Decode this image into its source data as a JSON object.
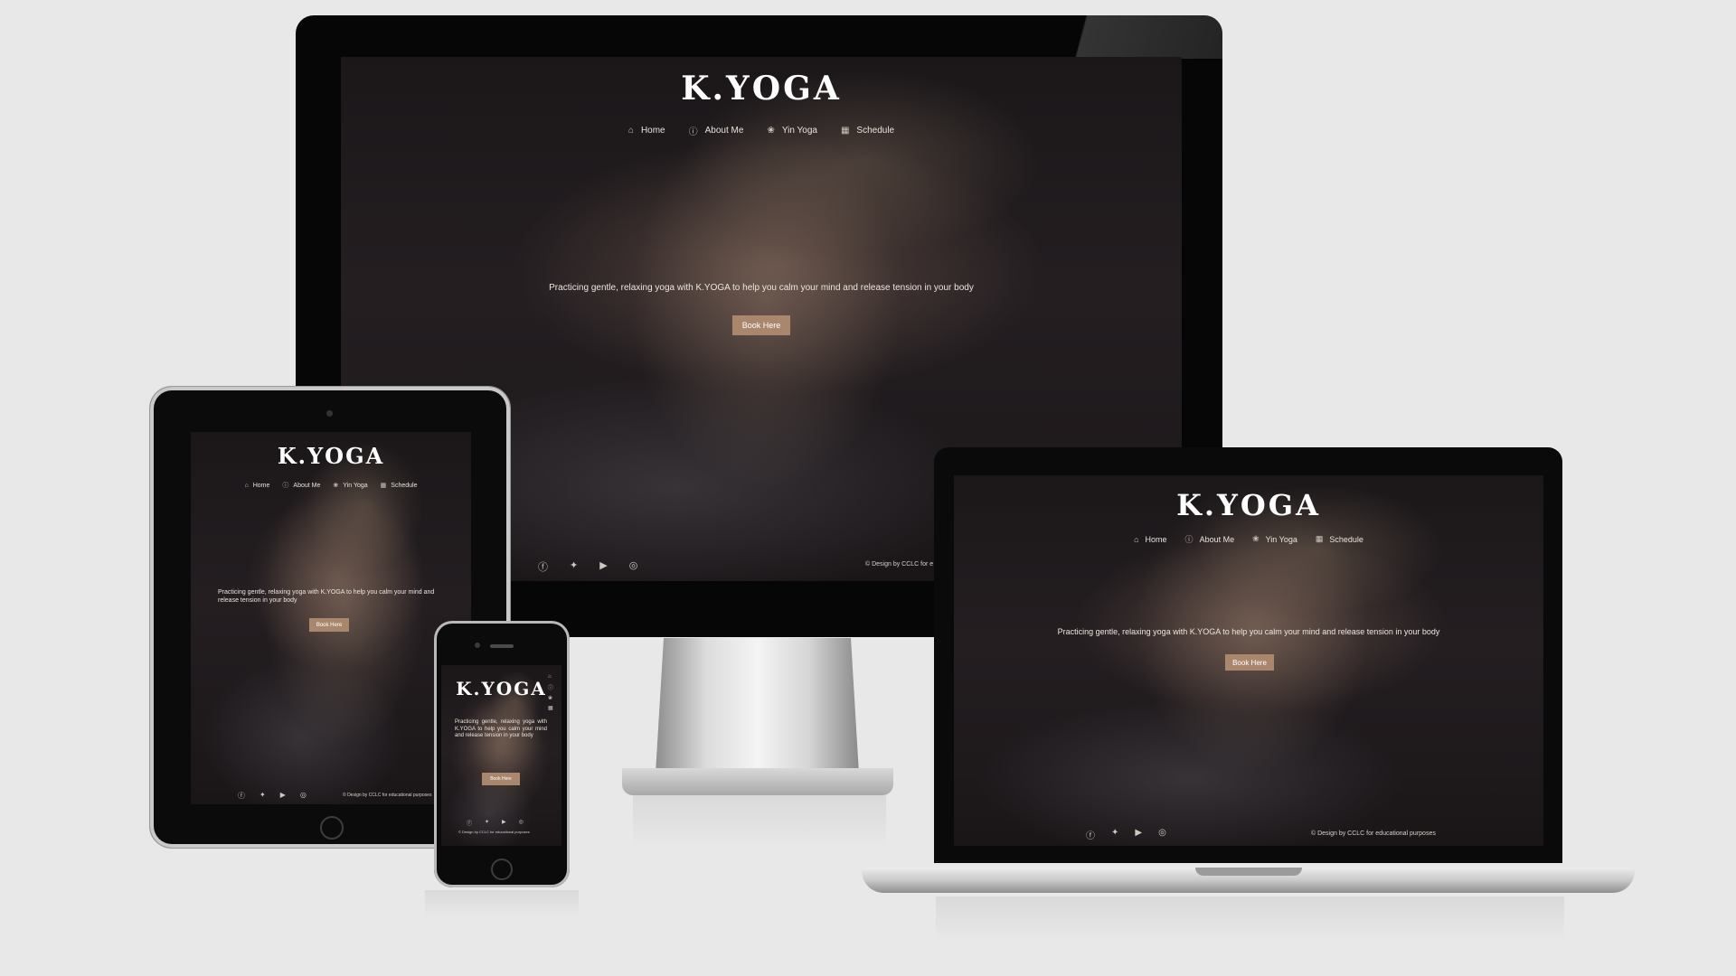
{
  "site": {
    "brand": "K.YOGA",
    "nav": [
      {
        "icon": "home-icon",
        "label": "Home"
      },
      {
        "icon": "info-icon",
        "label": "About Me"
      },
      {
        "icon": "lotus-icon",
        "label": "Yin Yoga"
      },
      {
        "icon": "calendar-icon",
        "label": "Schedule"
      }
    ],
    "tagline": "Practicing gentle, relaxing yoga with K.YOGA to help you calm your mind and release tension in your body",
    "book_button": "Book Here",
    "social": [
      "facebook-icon",
      "twitter-icon",
      "youtube-icon",
      "instagram-icon"
    ],
    "copyright_imac": "© Design by CCLC for e",
    "copyright_laptop": "© Design by CCLC for educational purposes",
    "copyright_tablet": "© Design by CCLC for educational purposes",
    "copyright_phone": "© Design by CCLC for educational purposes"
  },
  "colors": {
    "page_background": "#e8e8e8",
    "accent_button": "#a8876d",
    "device_frame": "#0a0a0a"
  }
}
